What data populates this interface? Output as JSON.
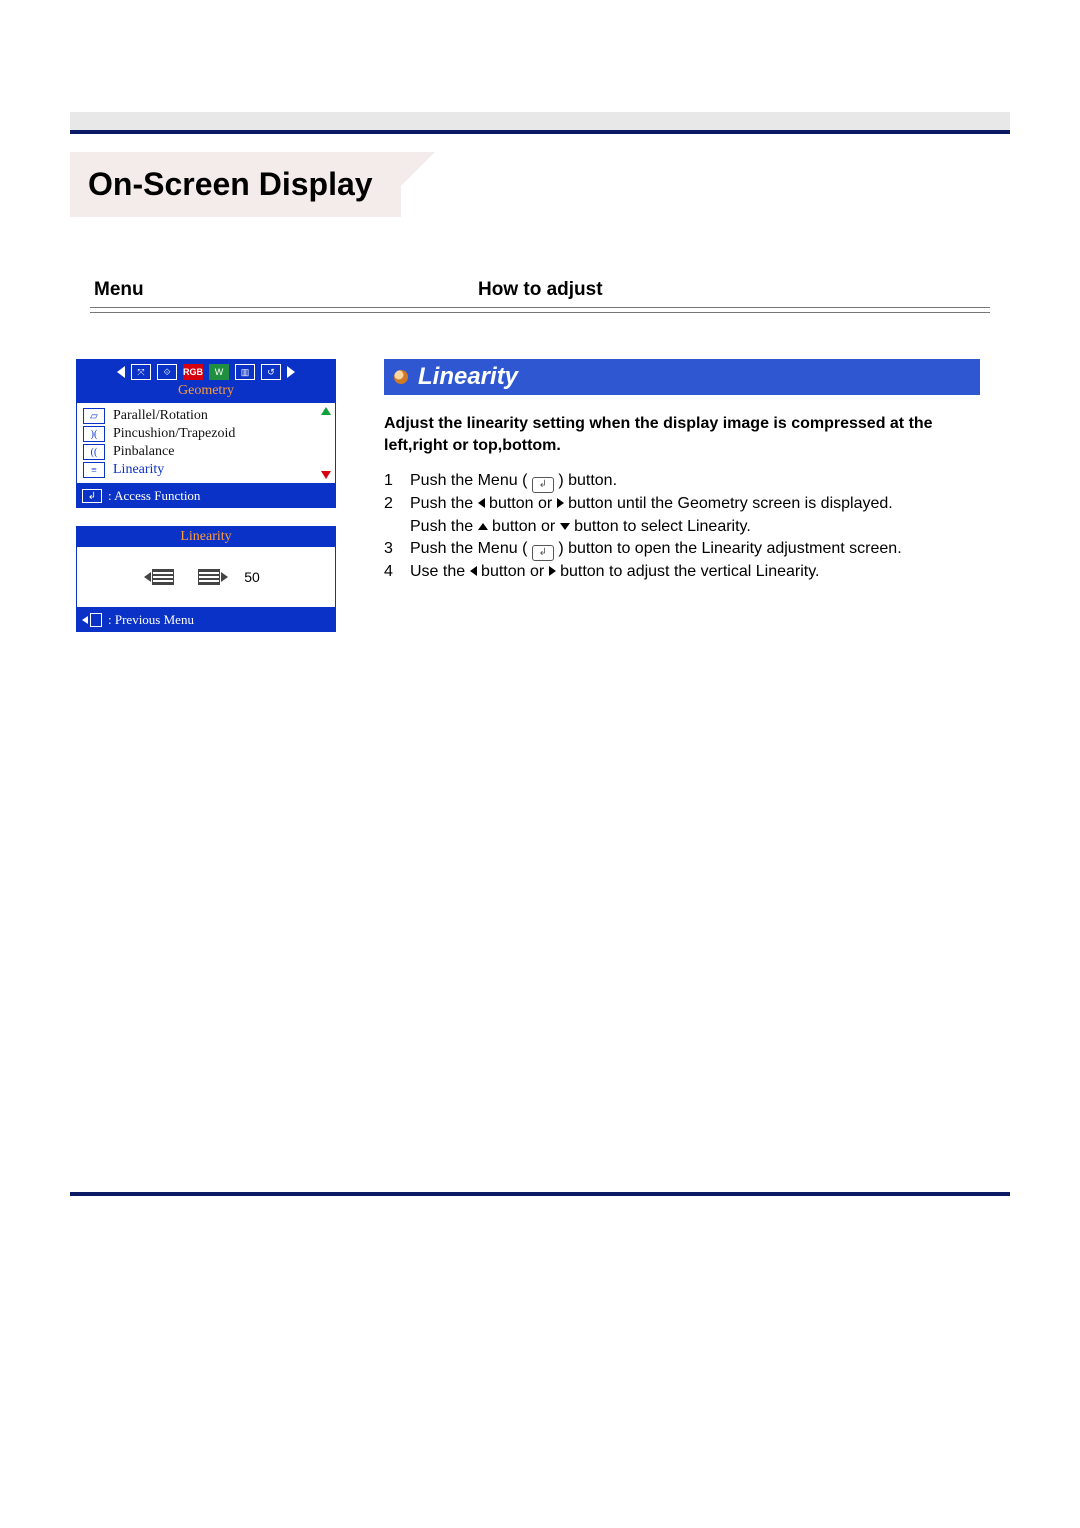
{
  "page_title": "On-Screen Display",
  "section_headers": {
    "menu": "Menu",
    "howto": "How to adjust"
  },
  "osd": {
    "tab_label": "Geometry",
    "items": [
      {
        "label": "Parallel/Rotation"
      },
      {
        "label": "Pincushion/Trapezoid"
      },
      {
        "label": "Pinbalance"
      },
      {
        "label": "Linearity"
      }
    ],
    "access_label": ": Access Function",
    "adjust": {
      "title": "Linearity",
      "value": "50"
    },
    "prev_label": ": Previous Menu"
  },
  "feature": {
    "title": "Linearity",
    "description": "Adjust the linearity setting when the display image is compressed at the left,right or top,bottom.",
    "steps": {
      "s1a": "Push the Menu (",
      "s1b": ") button.",
      "s2a": "Push the ",
      "s2b": " button or ",
      "s2c": " button until the Geometry screen is displayed.",
      "s2d": "Push the ",
      "s2e": " button or ",
      "s2f": " button to select Linearity.",
      "s3a": "Push the Menu (",
      "s3b": ") button to open the Linearity adjustment screen.",
      "s4a": "Use the ",
      "s4b": " button or ",
      "s4c": " button to adjust the vertical Linearity."
    },
    "nums": {
      "n1": "1",
      "n2": "2",
      "n3": "3",
      "n4": "4"
    }
  }
}
